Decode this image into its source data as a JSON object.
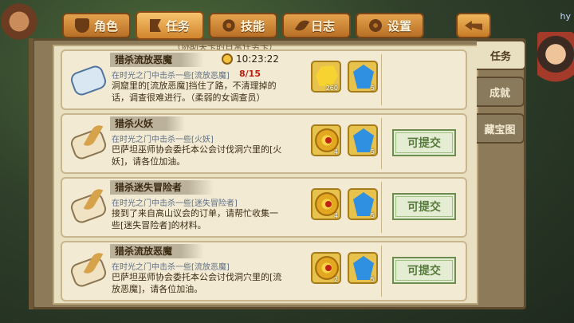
{
  "screen": {
    "corner_label": "hy"
  },
  "tabs": [
    {
      "label": "角色",
      "icon": "shield-icon",
      "active": false
    },
    {
      "label": "任务",
      "icon": "flag-icon",
      "active": true
    },
    {
      "label": "技能",
      "icon": "gear-icon",
      "active": false
    },
    {
      "label": "日志",
      "icon": "feather-icon",
      "active": false
    },
    {
      "label": "设置",
      "icon": "settings-icon",
      "active": false
    }
  ],
  "side_tabs": [
    {
      "label": "任务",
      "active": true
    },
    {
      "label": "成就",
      "active": false
    },
    {
      "label": "藏宝图",
      "active": false
    }
  ],
  "quest_list": {
    "cut_text": "（协助关卡的日常任务卡）",
    "submit_label": "可提交",
    "quests": [
      {
        "title": "猎杀流放恶魔",
        "target": "在时光之门中击杀一些[流放恶魔]",
        "progress": "8/15",
        "timer": "10:23:22",
        "desc": "洞窟里的[流放恶魔]挡住了路，不清理掉的话，调查很难进行。（柔弱的女调查员）",
        "rewards": [
          {
            "type": "gold",
            "icon": "gold-icon",
            "count": "260"
          },
          {
            "type": "diamond",
            "icon": "diamond-icon",
            "count": "5"
          }
        ],
        "submittable": false
      },
      {
        "title": "猎杀火妖",
        "target": "在时光之门中击杀一些[火妖]",
        "desc": "巴萨坦巫师协会委托本公会讨伐洞穴里的[火妖]，请各位加油。",
        "rewards": [
          {
            "type": "coin",
            "icon": "guild-coin-icon",
            "count": "4"
          },
          {
            "type": "diamond",
            "icon": "diamond-icon",
            "count": "5"
          }
        ],
        "submittable": true
      },
      {
        "title": "猎杀迷失冒险者",
        "target": "在时光之门中击杀一些[迷失冒险者]",
        "desc": "接到了来自高山议会的订单，请帮忙收集一些[迷失冒险者]的材料。",
        "rewards": [
          {
            "type": "coin",
            "icon": "guild-coin-icon",
            "count": "4"
          },
          {
            "type": "diamond",
            "icon": "diamond-icon",
            "count": "5"
          }
        ],
        "submittable": true
      },
      {
        "title": "猎杀流放恶魔",
        "target": "在时光之门中击杀一些[流放恶魔]",
        "desc": "巴萨坦巫师协会委托本公会讨伐洞穴里的[流放恶魔]，请各位加油。",
        "rewards": [
          {
            "type": "coin",
            "icon": "guild-coin-icon",
            "count": "2"
          },
          {
            "type": "diamond",
            "icon": "diamond-icon",
            "count": "5"
          }
        ],
        "submittable": true
      }
    ]
  }
}
